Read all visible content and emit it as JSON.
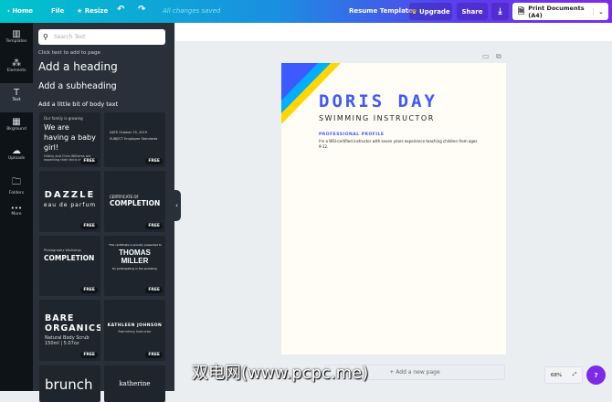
{
  "topbar": {
    "home": "Home",
    "file": "File",
    "resize": "Resize",
    "saved": "All changes saved",
    "resume_template": "Resume Template",
    "upgrade": "Upgrade",
    "share": "Share",
    "print": "Print Documents (A4)"
  },
  "rail": [
    {
      "label": "Templates",
      "icon": "▥"
    },
    {
      "label": "Elements",
      "icon": "⁂"
    },
    {
      "label": "Text",
      "icon": "T"
    },
    {
      "label": "Bkground",
      "icon": "▦"
    },
    {
      "label": "Uploads",
      "icon": "☁"
    },
    {
      "label": "Folders",
      "icon": "🗀"
    },
    {
      "label": "More",
      "icon": "•••"
    }
  ],
  "panel": {
    "search_placeholder": "Search Text",
    "hint": "Click text to add to page",
    "heading": "Add a heading",
    "subheading": "Add a subheading",
    "body": "Add a little bit of body text",
    "free": "FREE",
    "thumbs": [
      {
        "lines": [
          "Our family is growing",
          "We are having a baby girl!",
          "Hillary and Chris Williams are expecting their third child"
        ]
      },
      {
        "lines": [
          "DATE   October 25, 2019",
          "SUBJECT   Employee Standards"
        ]
      },
      {
        "lines": [
          "DAZZLE",
          "eau de parfum"
        ]
      },
      {
        "lines": [
          "CERTIFICATE OF",
          "COMPLETION"
        ]
      },
      {
        "lines": [
          "Photography Workshop",
          "COMPLETION"
        ]
      },
      {
        "lines": [
          "This certificate is proudly presented to",
          "THOMAS MILLER",
          "for participating in the workshop"
        ]
      },
      {
        "lines": [
          "BARE ORGANICS",
          "Natural Body Scrub",
          "150ml | 5.07oz"
        ]
      },
      {
        "lines": [
          "KATHLEEN JOHNSON",
          "Swimming Instructor"
        ]
      },
      {
        "lines": [
          "brunch"
        ]
      },
      {
        "lines": [
          "katherine"
        ]
      }
    ]
  },
  "document": {
    "name": "DORIS DAY",
    "title": "SWIMMING INSTRUCTOR",
    "section": "PROFESSIONAL PROFILE",
    "profile": "I'm a WSI-certified instructor with seven years experience teaching children from ages 9-12."
  },
  "footer": {
    "add_page": "+ Add a new page",
    "zoom": "68%",
    "help": "?"
  },
  "watermark": "双电网(www.pcpc.me)",
  "colors": {
    "accent": "#7d2ae8",
    "doc_blue": "#3d5afe",
    "stripe_cyan": "#00b0ff",
    "stripe_yellow": "#ffd600"
  }
}
